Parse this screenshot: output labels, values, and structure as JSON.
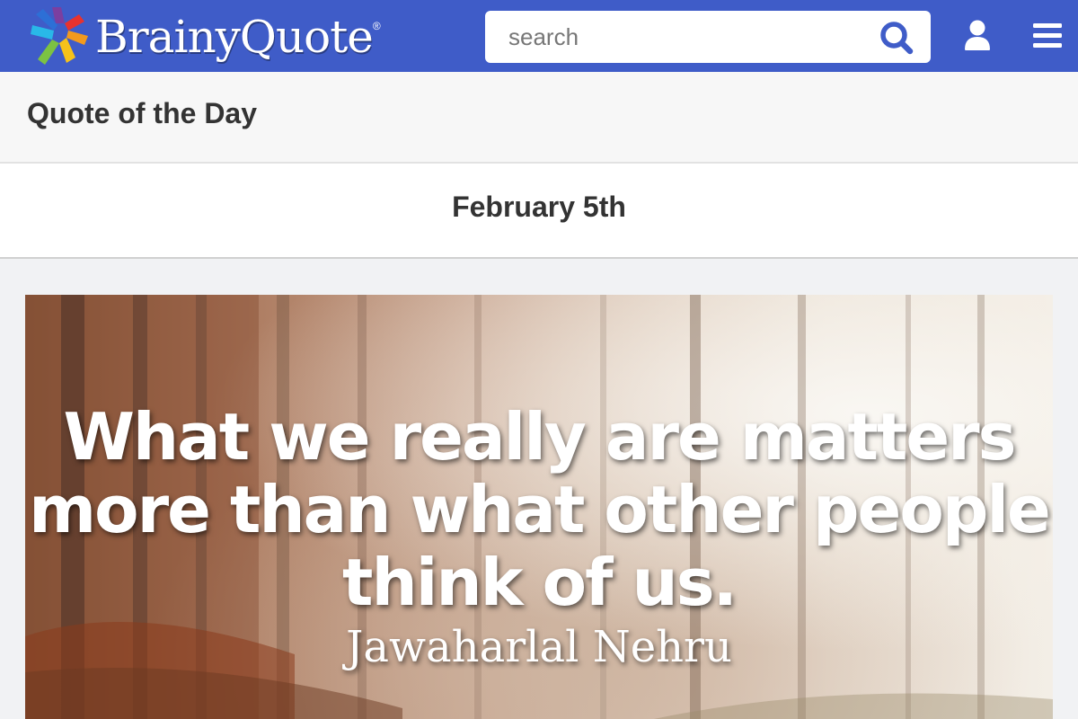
{
  "header": {
    "logo_text": "BrainyQuote",
    "logo_registered": "®",
    "brand_color": "#3f5cc8",
    "search": {
      "placeholder": "search",
      "value": ""
    },
    "icons": [
      "search-icon",
      "user-icon",
      "menu-icon"
    ]
  },
  "qotd": {
    "title": "Quote of the Day"
  },
  "date": {
    "text": "February 5th"
  },
  "quote": {
    "lines": [
      "What we really are matters",
      "more than what other people",
      "think of us."
    ],
    "author": "Jawaharlal Nehru"
  }
}
